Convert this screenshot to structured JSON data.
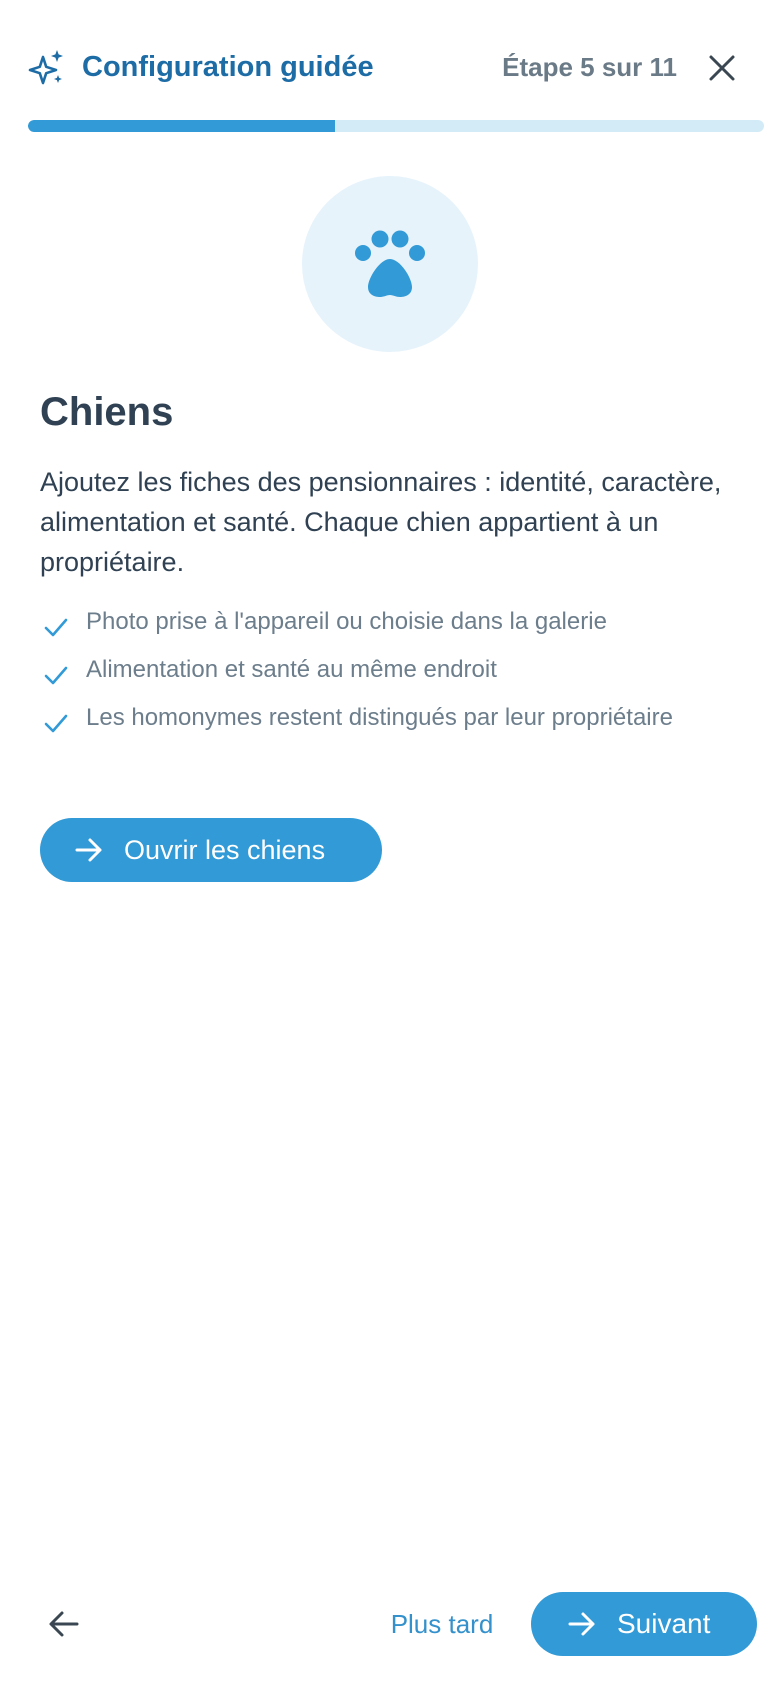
{
  "header": {
    "title": "Configuration guidée",
    "step_label": "Étape 5 sur 11",
    "sparkle_icon": "sparkle-icon",
    "close_icon": "close-icon"
  },
  "progress": {
    "current_step": 5,
    "total_steps": 11,
    "fraction": 0.4167,
    "fill_color": "#329ad6",
    "track_color": "#d3ebf7"
  },
  "hero": {
    "icon": "paw-icon",
    "icon_color": "#329ad6",
    "circle_color": "#e6f3fb"
  },
  "content": {
    "heading": "Chiens",
    "description": "Ajoutez les fiches des pensionnaires : identité, caractère, alimentation et santé. Chaque chien appartient à un propriétaire.",
    "features": [
      "Photo prise à l'appareil ou choisie dans la galerie",
      "Alimentation et santé au même endroit",
      "Les homonymes restent distingués par leur propriétaire"
    ],
    "action_label": "Ouvrir les chiens"
  },
  "footer": {
    "back_icon": "arrow-left-icon",
    "later_label": "Plus tard",
    "next_label": "Suivant"
  },
  "colors": {
    "accent": "#329ad6",
    "title": "#1d6ca6",
    "text_dark": "#2f4152",
    "text_muted": "#6c7d8b"
  }
}
